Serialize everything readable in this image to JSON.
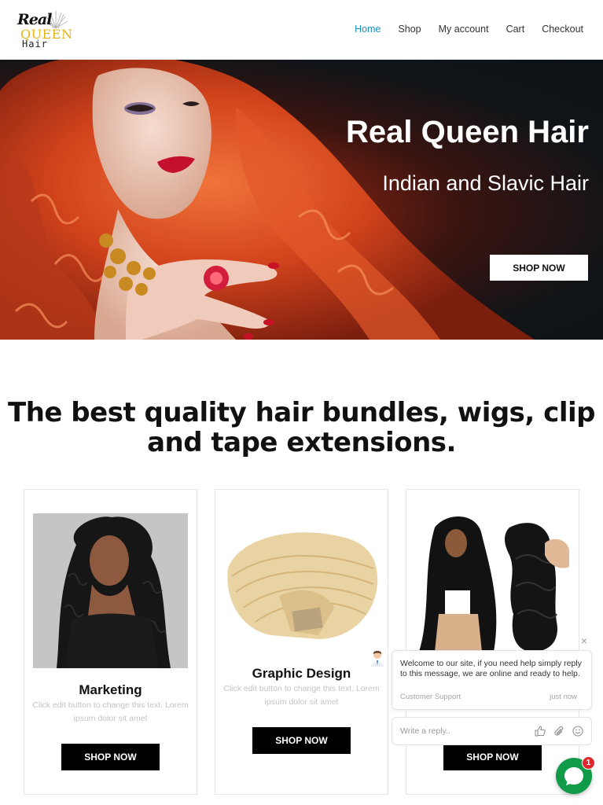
{
  "logo": {
    "line1": "Real",
    "line2": "QUEEN",
    "line3": "Hair"
  },
  "nav": {
    "items": [
      {
        "label": "Home"
      },
      {
        "label": "Shop"
      },
      {
        "label": "My account"
      },
      {
        "label": "Cart"
      },
      {
        "label": "Checkout"
      }
    ]
  },
  "hero": {
    "title": "Real Queen Hair",
    "subtitle": "Indian and Slavic Hair",
    "button_label": "SHOP NOW"
  },
  "headline": "The best quality hair bundles, wigs, clip and tape extensions.",
  "cards": [
    {
      "title": "Marketing",
      "description": "Click edit button to change this text. Lorem ipsum dolor sit amet",
      "button_label": "SHOP NOW"
    },
    {
      "title": "Graphic Design",
      "description": "Click edit button to change this text. Lorem ipsum dolor sit amet",
      "button_label": "SHOP NOW"
    },
    {
      "title": "",
      "description": "",
      "button_label": "SHOP NOW"
    }
  ],
  "chat": {
    "message": "Welcome to our site, if you need help simply reply to this message, we are online and ready to help.",
    "sender": "Customer Support",
    "time": "just now",
    "input_placeholder": "Write a reply..",
    "badge_count": "1"
  },
  "colors": {
    "nav_active": "#1a8fbf",
    "chat_green": "#119a48",
    "badge_red": "#e0272d",
    "logo_gold": "#e4b40c"
  }
}
